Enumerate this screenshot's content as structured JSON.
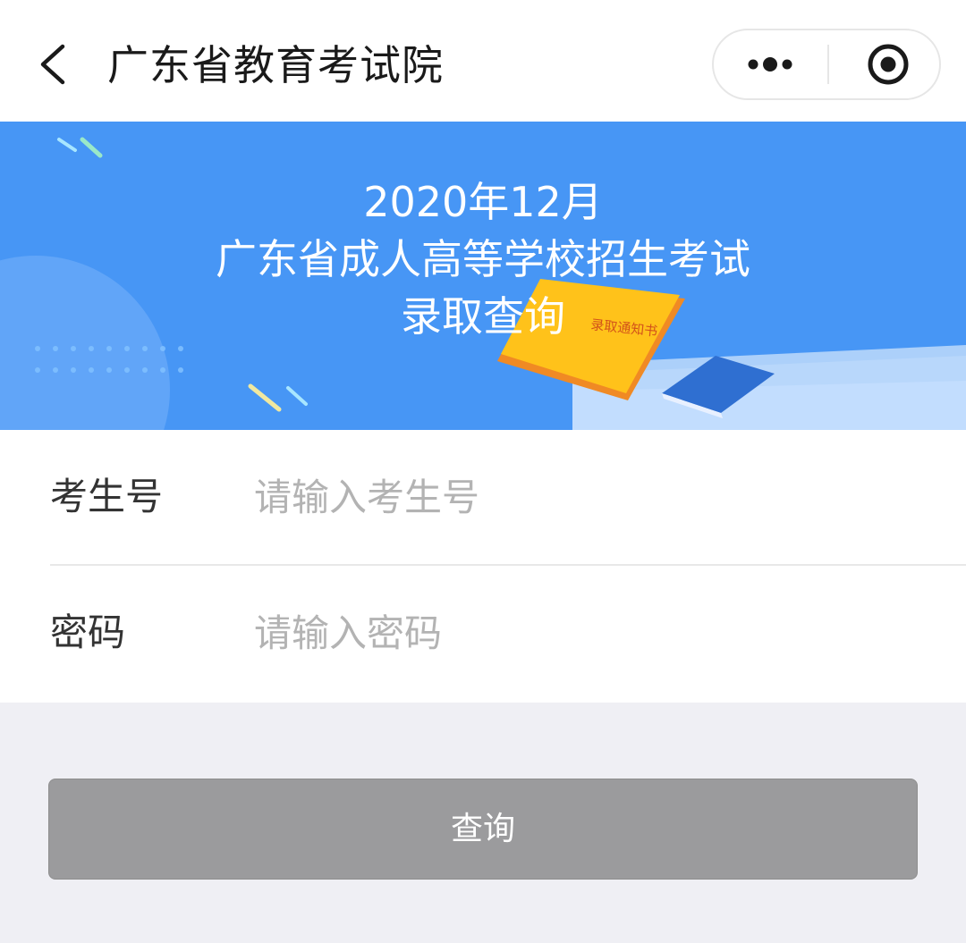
{
  "navbar": {
    "title": "广东省教育考试院",
    "back_icon": "chevron-left-icon",
    "more_icon": "more-dots-icon",
    "close_icon": "target-circle-icon"
  },
  "banner": {
    "line1": "2020年12月",
    "line2": "广东省成人高等学校招生考试",
    "line3": "录取查询",
    "book_text": "录取通知书",
    "background_color": "#4796f5",
    "book_color": "#ffc21a"
  },
  "form": {
    "student_id": {
      "label": "考生号",
      "placeholder": "请输入考生号",
      "value": ""
    },
    "password": {
      "label": "密码",
      "placeholder": "请输入密码",
      "value": ""
    }
  },
  "query_button": {
    "label": "查询",
    "color": "#9b9b9d"
  }
}
